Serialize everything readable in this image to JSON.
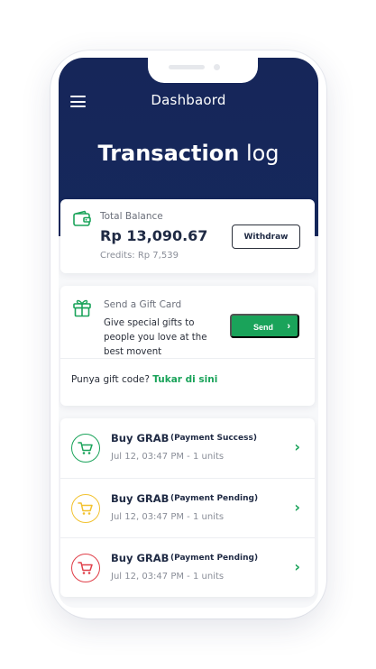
{
  "header": {
    "title": "Dashbaord",
    "heading_bold": "Transaction",
    "heading_light": "log",
    "menu_icon": "hamburger-icon"
  },
  "balance": {
    "label": "Total Balance",
    "amount": "Rp 13,090.67",
    "credits": "Credits: Rp 7,539",
    "withdraw_label": "Withdraw",
    "icon": "wallet-icon"
  },
  "gift": {
    "title": "Send a Gift Card",
    "description": "Give special gifts to people you love at the best movent",
    "send_label": "Send",
    "code_prompt": "Punya gift code?",
    "code_link": "Tukar di sini",
    "icon": "gift-icon"
  },
  "transactions": [
    {
      "title": "Buy GRAB",
      "status": "(Payment Success)",
      "meta": "Jul 12, 03:47 PM - 1 units",
      "color": "#1aa35a",
      "icon": "cart-icon"
    },
    {
      "title": "Buy GRAB",
      "status": "(Payment Pending)",
      "meta": "Jul 12, 03:47 PM - 1 units",
      "color": "#f2c230",
      "icon": "cart-icon"
    },
    {
      "title": "Buy GRAB",
      "status": "(Payment Pending)",
      "meta": "Jul 12, 03:47 PM - 1 units",
      "color": "#e0404a",
      "icon": "cart-icon"
    }
  ],
  "colors": {
    "header_bg": "#162659",
    "accent": "#1aa35a",
    "success": "#1aa35a",
    "pending": "#f2c230",
    "failed": "#e0404a"
  }
}
